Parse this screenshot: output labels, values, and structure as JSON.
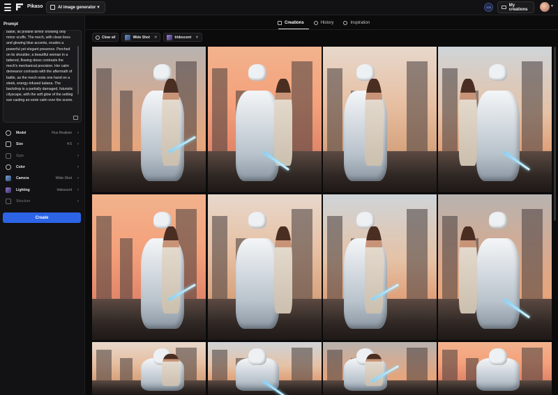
{
  "app": {
    "name": "Pikaso",
    "tool_selector": "AI image generator"
  },
  "header": {
    "credits_badge": "335",
    "my_creations": "My creations"
  },
  "sidebar": {
    "prompt_title": "Prompt",
    "prompt_text": "battle, its pristine armor showing only minor scuffs. The mech, with clean lines and glowing blue accents, exudes a powerful yet elegant presence. Perched on its shoulder, a beautiful woman in a tattered, flowing dress contrasts the mech's mechanical precision. Her calm demeanor contrasts with the aftermath of battle, as the mech rests one hand on a sleek, energy-infused katana. The backdrop is a partially damaged, futuristic cityscape, with the soft glow of the setting sun casting an eerie calm over the scene.",
    "settings": [
      {
        "label": "Model",
        "value": "Flux Realism",
        "icon": "model-icon"
      },
      {
        "label": "Size",
        "value": "4:5",
        "icon": "size-icon"
      },
      {
        "label": "Style",
        "value": "",
        "icon": "style-icon"
      },
      {
        "label": "Color",
        "value": "",
        "icon": "color-icon"
      },
      {
        "label": "Camera",
        "value": "Wide-Shot",
        "icon": "camera-thumbnail"
      },
      {
        "label": "Lighting",
        "value": "Iridescent",
        "icon": "lighting-thumbnail"
      },
      {
        "label": "Structure",
        "value": "",
        "icon": "structure-icon"
      }
    ],
    "create_button": "Create"
  },
  "tabs": [
    {
      "label": "Creations",
      "icon": "grid-icon",
      "active": true
    },
    {
      "label": "History",
      "icon": "history-icon",
      "active": false
    },
    {
      "label": "Inspiration",
      "icon": "inspiration-icon",
      "active": false
    }
  ],
  "filters": [
    {
      "label": "Clear all",
      "icon": "clear-icon"
    },
    {
      "label": "Wide Shot",
      "icon": "wide-shot-thumbnail"
    },
    {
      "label": "Iridescent",
      "icon": "iridescent-thumbnail"
    }
  ],
  "colors": {
    "accent": "#2d64e6",
    "background": "#0b0b0c",
    "panel": "#121214"
  },
  "gallery": {
    "images": [
      {
        "description": "woman embracing kneeling white mech"
      },
      {
        "description": "mech standing with glowing blade, woman on shoulder"
      },
      {
        "description": "mech with katana facing woman"
      },
      {
        "description": "woman seated on crouching mech"
      },
      {
        "description": "mech with sword, woman on shoulder"
      },
      {
        "description": "woman in helmet seated on mech"
      },
      {
        "description": "woman sitting in mech's lap"
      },
      {
        "description": "woman in front of large mech with blade"
      },
      {
        "description": "mech with woman on shoulder"
      },
      {
        "description": "mech head close-up"
      },
      {
        "description": "mech with woman in front"
      },
      {
        "description": "mech facing woman"
      }
    ]
  }
}
